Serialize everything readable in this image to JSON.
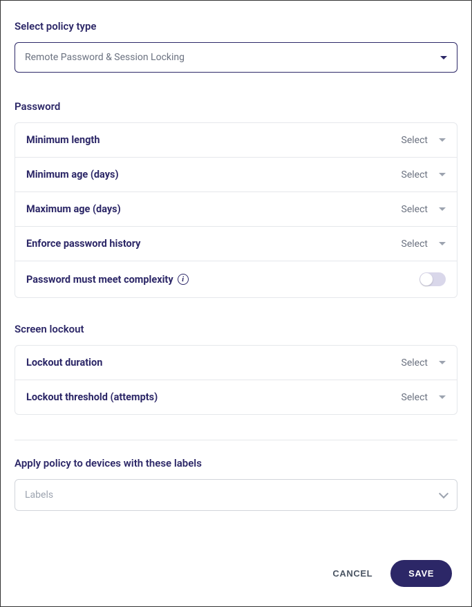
{
  "policy_type": {
    "label": "Select policy type",
    "selected": "Remote Password & Session Locking"
  },
  "password": {
    "section_label": "Password",
    "rows": {
      "min_length": {
        "label": "Minimum length",
        "select_text": "Select"
      },
      "min_age": {
        "label": "Minimum age (days)",
        "select_text": "Select"
      },
      "max_age": {
        "label": "Maximum age (days)",
        "select_text": "Select"
      },
      "history": {
        "label": "Enforce password history",
        "select_text": "Select"
      },
      "complexity": {
        "label": "Password must meet complexity",
        "toggle_on": false
      }
    }
  },
  "screen_lockout": {
    "section_label": "Screen lockout",
    "rows": {
      "duration": {
        "label": "Lockout duration",
        "select_text": "Select"
      },
      "threshold": {
        "label": "Lockout threshold (attempts)",
        "select_text": "Select"
      }
    }
  },
  "apply_labels": {
    "section_label": "Apply policy to devices with these labels",
    "placeholder": "Labels"
  },
  "footer": {
    "cancel": "CANCEL",
    "save": "SAVE"
  }
}
